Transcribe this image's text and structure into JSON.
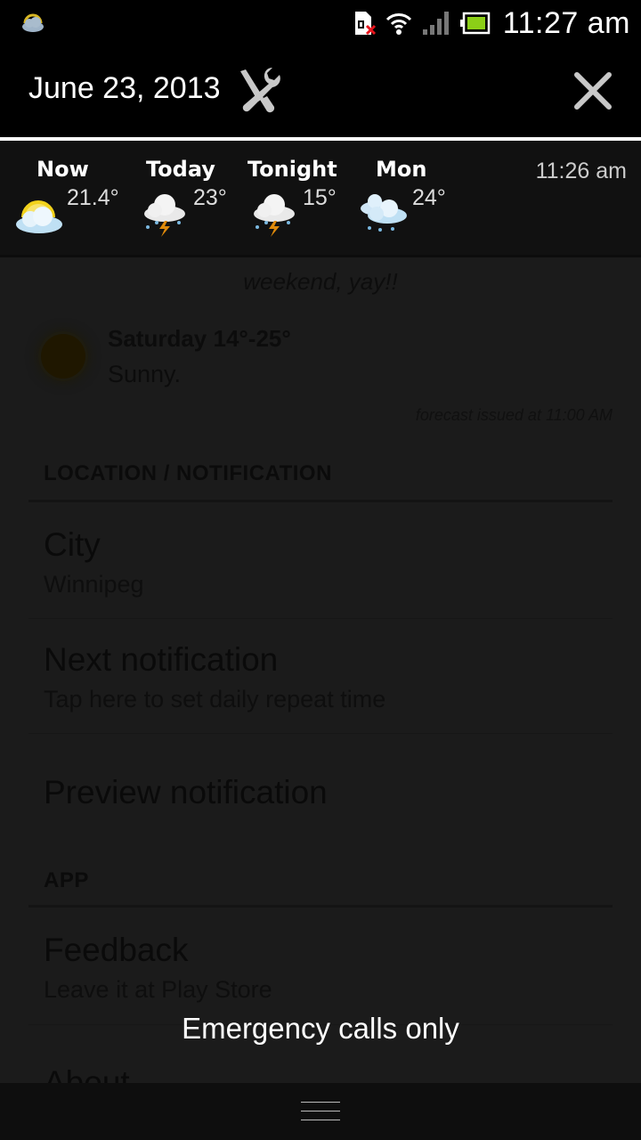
{
  "status_bar": {
    "time": "11:27 am",
    "icons": [
      "weather-partly-cloudy-icon",
      "sim-card-missing-icon",
      "wifi-icon",
      "signal-strength-icon",
      "battery-icon"
    ]
  },
  "notification_header": {
    "date": "June 23, 2013",
    "settings_icon": "tools-icon",
    "close_icon": "close-icon"
  },
  "weather_notification": {
    "updated_time": "11:26 am",
    "periods": [
      {
        "label": "Now",
        "temp": "21.4°",
        "icon": "partly-sunny-icon"
      },
      {
        "label": "Today",
        "temp": "23°",
        "icon": "thunderstorm-icon"
      },
      {
        "label": "Tonight",
        "temp": "15°",
        "icon": "thunderstorm-icon"
      },
      {
        "label": "Mon",
        "temp": "24°",
        "icon": "rain-clouds-icon"
      }
    ]
  },
  "app": {
    "tagline": "weekend, yay!!",
    "forecast": {
      "title": "Saturday 14°-25°",
      "description": "Sunny.",
      "issued": "forecast issued at 11:00 AM",
      "icon": "sun-icon"
    },
    "sections": [
      {
        "header": "LOCATION / NOTIFICATION",
        "items": [
          {
            "title": "City",
            "subtitle": "Winnipeg"
          },
          {
            "title": "Next notification",
            "subtitle": "Tap here to set daily repeat time"
          },
          {
            "title": "Preview notification",
            "subtitle": ""
          }
        ]
      },
      {
        "header": "APP",
        "items": [
          {
            "title": "Feedback",
            "subtitle": "Leave it at Play Store"
          },
          {
            "title": "About",
            "subtitle": ""
          }
        ]
      }
    ]
  },
  "carrier_label": "Emergency calls only",
  "colors": {
    "accent_yellow": "#f2d21b",
    "battery_green": "#8ccf17",
    "sim_error_red": "#e8141c"
  }
}
